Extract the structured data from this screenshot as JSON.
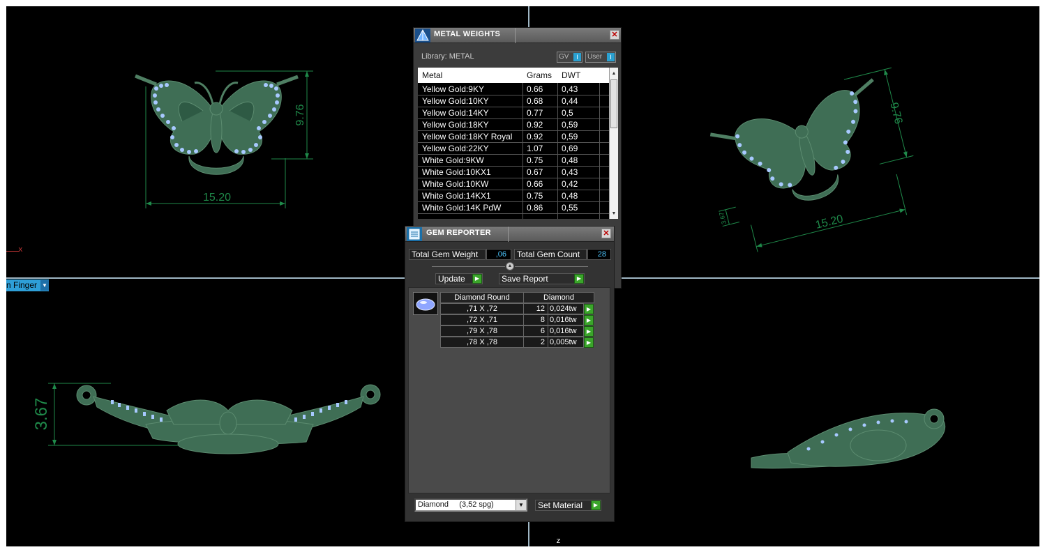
{
  "viewport": {
    "axis_x_label": "x",
    "axis_z_label": "z",
    "view_dropdown_label": "n Finger",
    "top_left": {
      "width_dim": "15.20",
      "height_dim": "9.76"
    },
    "top_right": {
      "width_dim": "15.20",
      "height_dim": "9.76",
      "small_dim": "3.67"
    },
    "bottom_left": {
      "height_dim": "3.67"
    },
    "model_color": "#3f6e55"
  },
  "metal_weights": {
    "title": "METAL WEIGHTS",
    "library_label": "Library: METAL",
    "toggle_gv": "GV",
    "toggle_user": "User",
    "columns": [
      "Metal",
      "Grams",
      "DWT"
    ],
    "rows": [
      [
        "Yellow Gold:9KY",
        "0.66",
        "0,43"
      ],
      [
        "Yellow Gold:10KY",
        "0.68",
        "0,44"
      ],
      [
        "Yellow Gold:14KY",
        "0.77",
        "0,5"
      ],
      [
        "Yellow Gold:18KY",
        "0.92",
        "0,59"
      ],
      [
        "Yellow Gold:18KY Royal",
        "0.92",
        "0,59"
      ],
      [
        "Yellow Gold:22KY",
        "1.07",
        "0,69"
      ],
      [
        "White Gold:9KW",
        "0.75",
        "0,48"
      ],
      [
        "White Gold:10KX1",
        "0.67",
        "0,43"
      ],
      [
        "White Gold:10KW",
        "0.66",
        "0,42"
      ],
      [
        "White Gold:14KX1",
        "0.75",
        "0,48"
      ],
      [
        "White Gold:14K PdW",
        "0.86",
        "0,55"
      ]
    ]
  },
  "gem_reporter": {
    "title": "GEM REPORTER",
    "total_weight_label": "Total Gem Weight",
    "total_weight_value": ",06",
    "total_count_label": "Total Gem Count",
    "total_count_value": "28",
    "update_label": "Update",
    "save_report_label": "Save Report",
    "table_headers": [
      "Diamond Round",
      "Diamond"
    ],
    "gems": [
      {
        "size": ",71 X ,72",
        "count": "12",
        "weight": "0,024tw"
      },
      {
        "size": ",72 X ,71",
        "count": "8",
        "weight": "0,016tw"
      },
      {
        "size": ",79 X ,78",
        "count": "6",
        "weight": "0,016tw"
      },
      {
        "size": ",78 X ,78",
        "count": "2",
        "weight": "0,005tw"
      }
    ],
    "material_select": "Diamond     (3,52 spg)",
    "set_material_label": "Set Material"
  }
}
